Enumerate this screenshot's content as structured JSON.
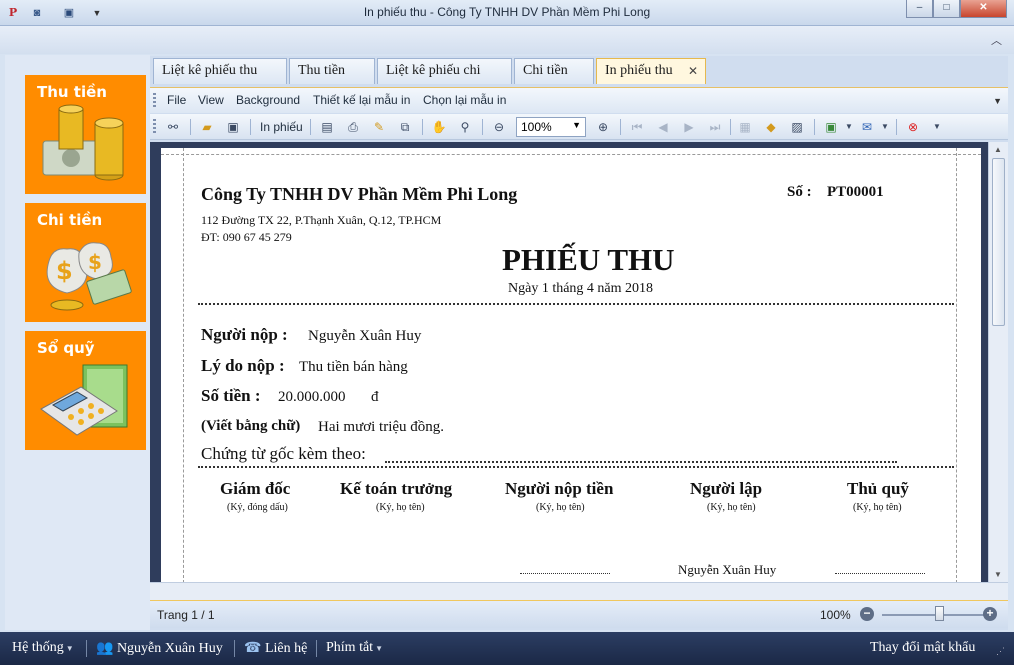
{
  "window": {
    "title": "In phiếu thu - Công Ty TNHH DV Phần Mềm Phi Long",
    "app_icon": "letter-p-logo-icon",
    "quick_access": [
      "camera-icon",
      "layout-icon",
      "dropdown-arrow-icon"
    ],
    "buttons": {
      "minimize": "–",
      "maximize": "□",
      "close": "✕"
    }
  },
  "left_nav": [
    {
      "label": "Thu tiền",
      "icon": "gold-coins-cash-icon"
    },
    {
      "label": "Chi tiền",
      "icon": "money-bags-icon"
    },
    {
      "label": "Sổ quỹ",
      "icon": "calculator-ledger-icon"
    }
  ],
  "tabs": [
    {
      "label": "Liệt kê phiếu thu",
      "active": false
    },
    {
      "label": "Thu tiền",
      "active": false
    },
    {
      "label": "Liệt kê phiếu chi",
      "active": false
    },
    {
      "label": "Chi tiền",
      "active": false
    },
    {
      "label": "In phiếu thu",
      "active": true
    }
  ],
  "menu": [
    "File",
    "View",
    "Background",
    "Thiết kế lại mẫu in",
    "Chọn lại mẫu in"
  ],
  "toolbar": {
    "print_label": "In phiếu",
    "zoom_value": "100%"
  },
  "receipt": {
    "company": "Công Ty TNHH DV Phần Mềm Phi Long",
    "address": "112 Đường TX 22, P.Thạnh Xuân, Q.12, TP.HCM",
    "phone": "ĐT: 090 67 45 279",
    "number_label": "Số :",
    "number_value": "PT00001",
    "title": "PHIẾU THU",
    "date": "Ngày 1 tháng 4 năm 2018",
    "payer_label": "Người nộp :",
    "payer_value": "Nguyễn Xuân Huy",
    "reason_label": "Lý do nộp :",
    "reason_value": "Thu tiền bán hàng",
    "amount_label": "Số tiền :",
    "amount_value": "20.000.000",
    "currency": "đ",
    "words_label": "(Viết bằng chữ)",
    "words_value": "Hai mươi triệu đồng.",
    "attached_label": "Chứng từ gốc kèm theo:",
    "signatures": [
      {
        "title": "Giám đốc",
        "note": "(Ký, đóng dấu)"
      },
      {
        "title": "Kế toán trưởng",
        "note": "(Ký, họ tên)"
      },
      {
        "title": "Người nộp tiền",
        "note": "(Ký, họ tên)"
      },
      {
        "title": "Người lập",
        "note": "(Ký, họ tên)"
      },
      {
        "title": "Thủ quỹ",
        "note": "(Ký, họ tên)"
      }
    ],
    "preparer_name": "Nguyễn Xuân Huy"
  },
  "status": {
    "page": "Trang 1 / 1",
    "zoom": "100%",
    "zoom_fraction": 0.55
  },
  "bottom_bar": {
    "system": "Hệ thống",
    "user": "Nguyễn Xuân Huy",
    "contact": "Liên hệ",
    "shortcuts": "Phím tắt",
    "change_password": "Thay đổi mật khẩu"
  }
}
